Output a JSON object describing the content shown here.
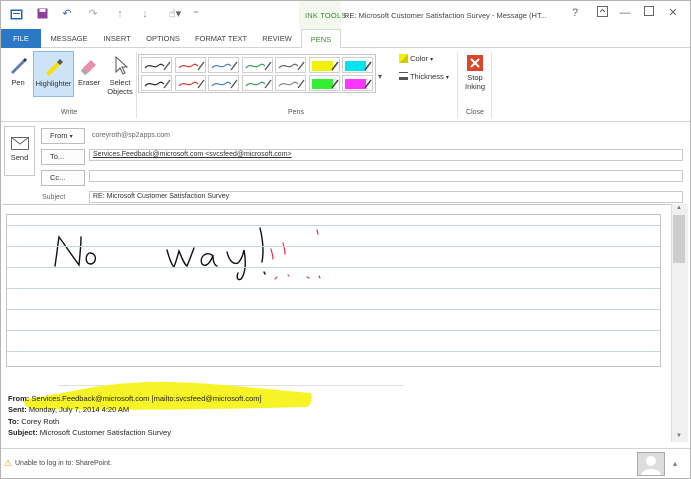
{
  "window": {
    "context_label": "INK TOOLS",
    "title": "RE: Microsoft Customer Satisfaction Survey - Message (HT...",
    "help": "?",
    "minimize": "—",
    "close": "✕"
  },
  "tabs": [
    "FILE",
    "MESSAGE",
    "INSERT",
    "OPTIONS",
    "FORMAT TEXT",
    "REVIEW",
    "PENS"
  ],
  "ribbon": {
    "write_group": {
      "pen": "Pen",
      "highlighter": "Highlighter",
      "eraser": "Eraser",
      "select_objects": "Select Objects",
      "label": "Write"
    },
    "pens_group": {
      "label": "Pens"
    },
    "color": "Color",
    "thickness": "Thickness",
    "close_group": {
      "stop_inking": "Stop Inking",
      "label": "Close"
    },
    "pen_colors": [
      "#333333",
      "#d93a3a",
      "#4a7cc7",
      "#3a9d58",
      "#666666",
      "#f2f200",
      "#00e5f2",
      "#222222",
      "#d93a3a",
      "#4a7cc7",
      "#3a9d58",
      "#888888",
      "#33ee33",
      "#ff33ff"
    ],
    "accent": "#2b78c6"
  },
  "compose": {
    "send": "Send",
    "from_button": "From",
    "from_value": "coreyroth@sp2apps.com",
    "to_button": "To...",
    "to_value": "Services.Feedback@microsoft.com <svcsfeed@microsoft.com>",
    "cc_button": "Cc...",
    "cc_value": "",
    "subject_label": "Subject",
    "subject_value": "RE: Microsoft Customer Satisfaction Survey"
  },
  "ink": {
    "text": "No way!!",
    "ink_color": "#111111",
    "accent_color": "#e8323c"
  },
  "quoted": {
    "from_label": "From:",
    "from_value": "Services.Feedback@microsoft.com [mailto:svcsfeed@microsoft.com]",
    "sent_label": "Sent:",
    "sent_value": "Monday, July 7, 2014 4:20 AM",
    "to_label": "To:",
    "to_value": "Corey Roth",
    "subject_label": "Subject:",
    "subject_value": "Microsoft Customer Satisfaction Survey",
    "highlight_color": "#f6f31a"
  },
  "status": {
    "message": "Unable to log in to: SharePoint."
  }
}
